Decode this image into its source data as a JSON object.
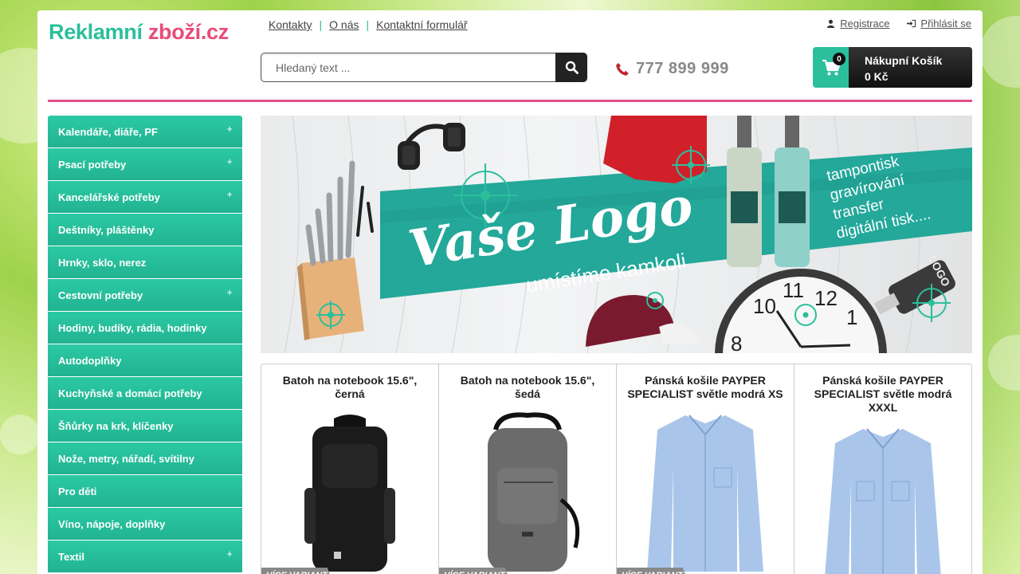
{
  "logo": {
    "part1": "Reklamní",
    "part2": "zboží.cz"
  },
  "topnav": {
    "contacts": "Kontakty",
    "about": "O nás",
    "contact_form": "Kontaktní formulář"
  },
  "account": {
    "register": "Registrace",
    "login": "Přihlásit se"
  },
  "search": {
    "placeholder": "Hledaný text ..."
  },
  "phone": "777 899 999",
  "cart": {
    "count": "0",
    "label": "Nákupní Košík",
    "total": "0 Kč"
  },
  "categories": [
    {
      "label": "Kalendáře, diáře, PF",
      "plus": "+"
    },
    {
      "label": "Psací potřeby",
      "plus": "+"
    },
    {
      "label": "Kancelářské potřeby",
      "plus": "+"
    },
    {
      "label": "Deštníky, pláštěnky",
      "plus": ""
    },
    {
      "label": "Hrnky, sklo, nerez",
      "plus": ""
    },
    {
      "label": "Cestovní potřeby",
      "plus": "+"
    },
    {
      "label": "Hodiny, budíky, rádia, hodinky",
      "plus": ""
    },
    {
      "label": "Autodoplňky",
      "plus": ""
    },
    {
      "label": "Kuchyňské a domácí potřeby",
      "plus": ""
    },
    {
      "label": "Šňůrky na krk, klíčenky",
      "plus": ""
    },
    {
      "label": "Nože, metry, nářadí, svítilny",
      "plus": ""
    },
    {
      "label": "Pro děti",
      "plus": ""
    },
    {
      "label": "Víno, nápoje, doplňky",
      "plus": ""
    },
    {
      "label": "Textil",
      "plus": "+"
    }
  ],
  "banner": {
    "headline": "Vaše Logo",
    "subline": "umístíme kamkoli",
    "services": [
      "tampontisk",
      "gravírování",
      "transfer",
      "digitální tisk...."
    ],
    "clock_numbers": [
      "10",
      "11",
      "12",
      "1",
      "8"
    ],
    "usb_text": "LOGO"
  },
  "products": [
    {
      "title": "Batoh na notebook 15.6\", černá",
      "variant": "VÍCE VARIANT",
      "color": "#1b1b1b"
    },
    {
      "title": "Batoh na notebook 15.6\", šedá",
      "variant": "VÍCE VARIANT",
      "color": "#6b6b6b"
    },
    {
      "title": "Pánská košile PAYPER SPECIALIST světle modrá XS",
      "variant": "VÍCE VARIANT",
      "color": "#a9c6ea"
    },
    {
      "title": "Pánská košile PAYPER SPECIALIST světle modrá XXXL",
      "variant": "",
      "color": "#a9c6ea"
    }
  ],
  "colors": {
    "accent": "#2bbf9c",
    "brand_pink": "#e94b7a",
    "dark": "#222222"
  }
}
